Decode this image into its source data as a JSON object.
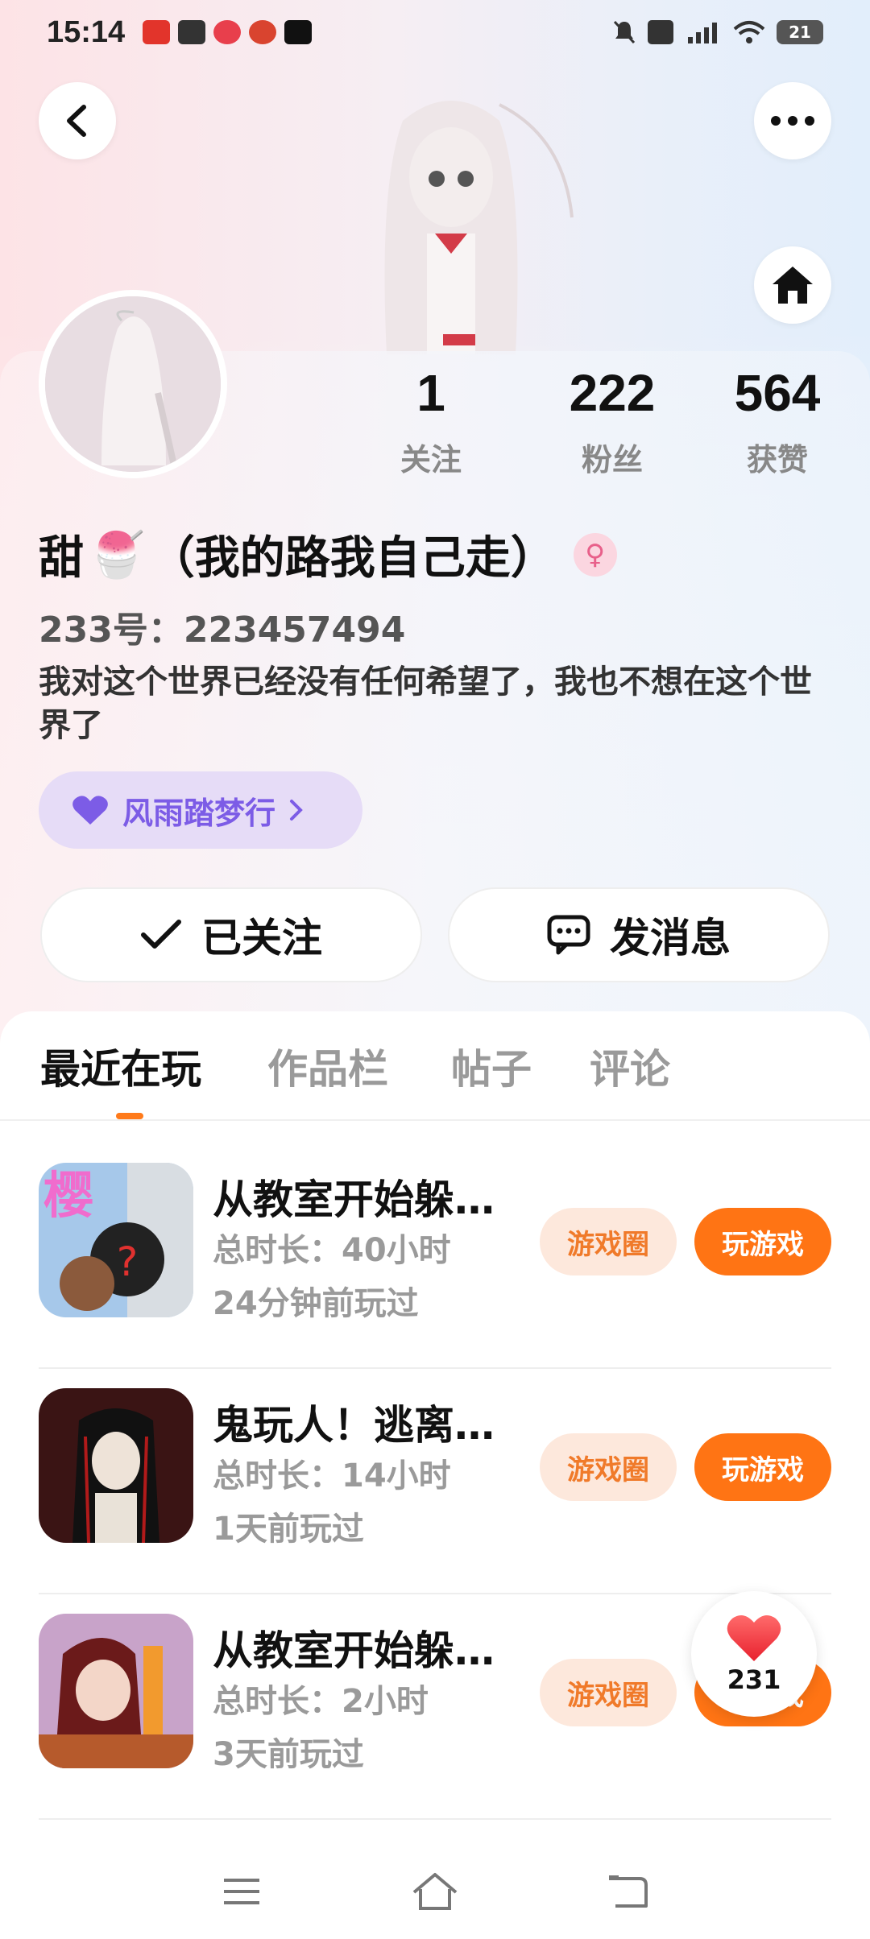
{
  "status_bar": {
    "time": "15:14",
    "battery": "21",
    "icons": [
      "toutiao-app-icon",
      "message-app-icon",
      "map-app-icon",
      "party-app-icon",
      "tiktok-app-icon",
      "mute-icon",
      "hd-icon",
      "5g-signal-icon",
      "wifi-icon",
      "battery-icon"
    ]
  },
  "header": {
    "back_icon": "chevron-left-icon",
    "more_icon": "more-horizontal-icon",
    "home_icon": "home-icon"
  },
  "profile": {
    "stats": [
      {
        "value": "1",
        "label": "关注"
      },
      {
        "value": "222",
        "label": "粉丝"
      },
      {
        "value": "564",
        "label": "获赞"
      }
    ],
    "name_prefix": "甜",
    "name_emoji": "🍧",
    "name_suffix": "（我的路我自己走）",
    "gender_symbol": "♀",
    "id_text": "233号：223457494",
    "bio": "我对这个世界已经没有任何希望了，我也不想在这个世界了",
    "tag_label": "风雨踏梦行",
    "follow_label": "已关注",
    "message_label": "发消息"
  },
  "tabs": [
    {
      "label": "最近在玩",
      "active": true
    },
    {
      "label": "作品栏",
      "active": false
    },
    {
      "label": "帖子",
      "active": false
    },
    {
      "label": "评论",
      "active": false
    }
  ],
  "games": [
    {
      "title": "从教室开始躲…",
      "duration": "总时长：40小时",
      "last_played": "24分钟前玩过",
      "icon_text": "樱",
      "circle_label": "游戏圈",
      "play_label": "玩游戏"
    },
    {
      "title": "鬼玩人！逃离…",
      "duration": "总时长：14小时",
      "last_played": "1天前玩过",
      "circle_label": "游戏圈",
      "play_label": "玩游戏"
    },
    {
      "title": "从教室开始躲…",
      "duration": "总时长：2小时",
      "last_played": "3天前玩过",
      "circle_label": "游戏圈",
      "play_label": "玩游戏"
    }
  ],
  "like_fab": {
    "count": "231"
  },
  "colors": {
    "accent": "#ff7414",
    "accent_light": "#fde8dc",
    "tag_bg": "#e6dcf7",
    "tag_text": "#7c5ce6"
  }
}
